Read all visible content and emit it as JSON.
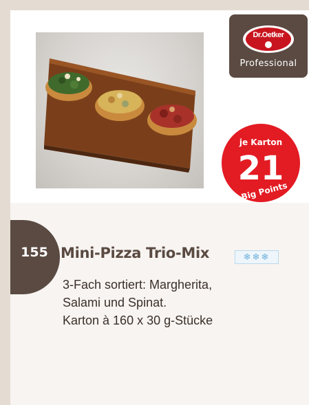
{
  "brand": {
    "logo_text": "Dr.Oetker",
    "subtitle": "Professional"
  },
  "badge": {
    "top_text": "je Karton",
    "number": "21",
    "bottom_text": "Big Points"
  },
  "product": {
    "number": "155",
    "title": "Mini-Pizza Trio-Mix",
    "frozen_symbol": "❄❄❄",
    "description": [
      "3-Fach sortiert: Margherita,",
      "Salami und Spinat.",
      "Karton à 160 x 30 g-Stücke"
    ]
  },
  "colors": {
    "page_bg": "#e4dcd3",
    "brand_brown": "#5a4a42",
    "badge_red": "#e31b23",
    "frost_blue": "#6fb0da"
  },
  "icons": {
    "frozen": "snowflake-icon"
  }
}
